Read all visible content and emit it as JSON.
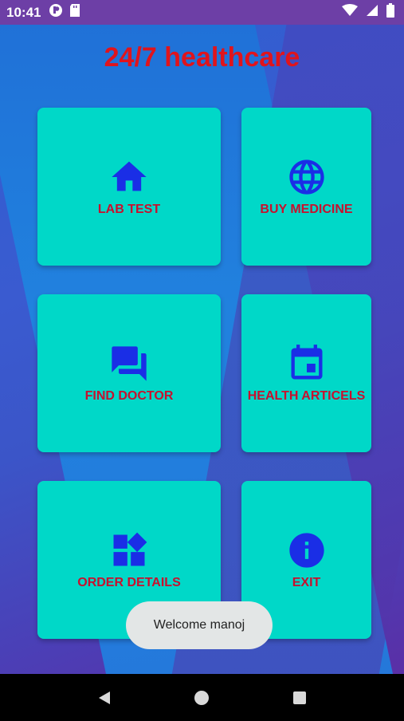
{
  "status_bar": {
    "time": "10:41",
    "icons": [
      "notification-icon",
      "sd-card-icon"
    ],
    "right_icons": [
      "wifi-icon",
      "signal-icon",
      "battery-icon"
    ]
  },
  "app": {
    "title": "24/7 healthcare",
    "cards": [
      {
        "label": "LAB TEST",
        "icon": "home-icon"
      },
      {
        "label": "BUY MEDICINE",
        "icon": "globe-icon"
      },
      {
        "label": "FIND DOCTOR",
        "icon": "chat-icon"
      },
      {
        "label": "HEALTH ARTICELS",
        "icon": "calendar-icon"
      },
      {
        "label": "ORDER DETAILS",
        "icon": "widgets-icon"
      },
      {
        "label": "EXIT",
        "icon": "info-icon"
      }
    ],
    "toast": "Welcome manoj"
  },
  "nav_bar": {
    "buttons": [
      "back-icon",
      "home-circle-icon",
      "recents-icon"
    ]
  },
  "colors": {
    "title": "#e0141c",
    "card_bg": "#00d8c8",
    "card_label": "#c8102e",
    "icon": "#1a2ee6",
    "status_bar": "#6d3fa6"
  }
}
